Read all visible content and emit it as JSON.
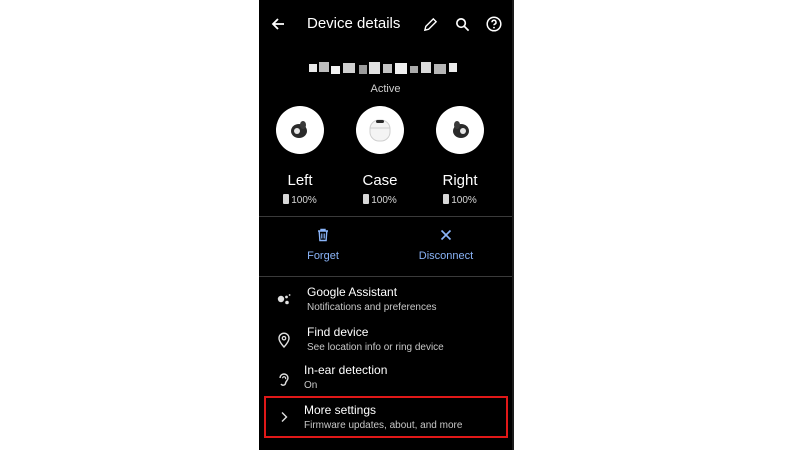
{
  "header": {
    "title": "Device details",
    "back_icon": "arrow-left-icon",
    "edit_icon": "pencil-icon",
    "search_icon": "search-icon",
    "help_icon": "help-icon"
  },
  "device": {
    "status": "Active"
  },
  "components": [
    {
      "label": "Left",
      "battery": "100%"
    },
    {
      "label": "Case",
      "battery": "100%"
    },
    {
      "label": "Right",
      "battery": "100%"
    }
  ],
  "actions": {
    "forget": "Forget",
    "disconnect": "Disconnect"
  },
  "settings": [
    {
      "title": "Google Assistant",
      "subtitle": "Notifications and preferences",
      "icon": "assistant-icon"
    },
    {
      "title": "Find device",
      "subtitle": "See location info or ring device",
      "icon": "location-pin-icon"
    },
    {
      "title": "In-ear detection",
      "subtitle": "On",
      "icon": "ear-icon"
    },
    {
      "title": "More settings",
      "subtitle": "Firmware updates, about, and more",
      "icon": "chevron-right-icon"
    }
  ],
  "colors": {
    "accent": "#8ab4f8",
    "highlight": "#e01818",
    "background": "#000000"
  }
}
